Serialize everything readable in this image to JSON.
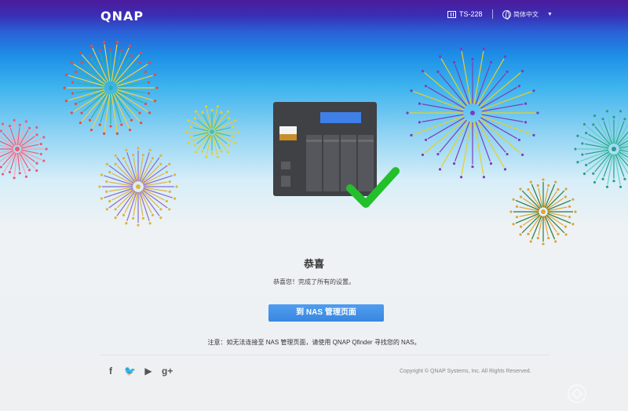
{
  "header": {
    "logo": "QNAP",
    "model": "TS-228",
    "language": "简体中文"
  },
  "main": {
    "title": "恭喜",
    "subtitle": "恭喜您！完成了所有的设置。",
    "button_label": "到 NAS 管理页面",
    "note": "注意：如无法连接至 NAS 管理页面，请使用 QNAP Qfinder 寻找您的 NAS。"
  },
  "footer": {
    "social": [
      {
        "name": "facebook-icon",
        "glyph": "f"
      },
      {
        "name": "twitter-icon",
        "glyph": "🐦"
      },
      {
        "name": "youtube-icon",
        "glyph": "▶"
      },
      {
        "name": "google-plus-icon",
        "glyph": "g+"
      }
    ],
    "copyright": "Copyright © QNAP Systems, Inc. All Rights Reserved."
  },
  "colors": {
    "primary_button": "#3a86df",
    "checkmark": "#22c02a",
    "nas_body": "#3f4145",
    "nas_screen": "#3f7fe8"
  }
}
